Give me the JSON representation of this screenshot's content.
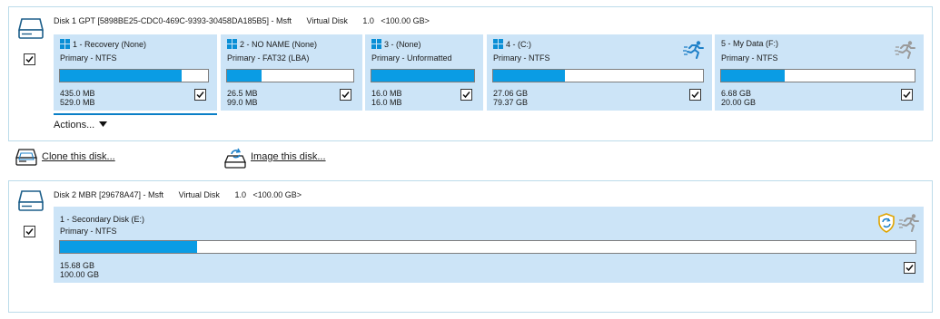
{
  "disk1": {
    "header": {
      "name": "Disk 1 GPT [5898BE25-CDC0-469C-9393-30458DA185B5] - Msft",
      "type": "Virtual Disk",
      "version": "1.0",
      "size": "<100.00 GB>"
    },
    "checked": true,
    "partitions": [
      {
        "title": "1 - Recovery (None)",
        "type": "Primary - NTFS",
        "used": "435.0 MB",
        "total": "529.0 MB",
        "fill": 0.82,
        "checked": true,
        "icon": "windows-icon"
      },
      {
        "title": "2 - NO NAME (None)",
        "type": "Primary - FAT32 (LBA)",
        "used": "26.5 MB",
        "total": "99.0 MB",
        "fill": 0.27,
        "checked": true,
        "icon": "windows-icon"
      },
      {
        "title": "3 - (None)",
        "type": "Primary - Unformatted",
        "used": "16.0 MB",
        "total": "16.0 MB",
        "fill": 1.0,
        "checked": true,
        "icon": "windows-icon"
      },
      {
        "title": "4 - (C:)",
        "type": "Primary - NTFS",
        "used": "27.06 GB",
        "total": "79.37 GB",
        "fill": 0.34,
        "checked": true,
        "icon": "windows-icon",
        "status_icon": "running-man-icon-blue"
      },
      {
        "title": "5 - My Data (F:)",
        "type": "Primary - NTFS",
        "used": "6.68 GB",
        "total": "20.00 GB",
        "fill": 0.33,
        "checked": true,
        "status_icon": "running-man-icon-grey"
      }
    ],
    "actions_label": "Actions..."
  },
  "links": {
    "clone": "Clone this disk...",
    "image": "Image this disk..."
  },
  "disk2": {
    "header": {
      "name": "Disk 2 MBR [29678A47] - Msft",
      "type": "Virtual Disk",
      "version": "1.0",
      "size": "<100.00 GB>"
    },
    "checked": true,
    "partitions": [
      {
        "title": "1 - Secondary Disk (E:)",
        "type": "Primary - NTFS",
        "used": "15.68 GB",
        "total": "100.00 GB",
        "fill": 0.16,
        "checked": true,
        "status_icons": [
          "shield-sync-icon",
          "running-man-icon-grey"
        ]
      }
    ]
  },
  "colors": {
    "partition_bg": "#cce4f7",
    "bar_fill": "#0a9ce4",
    "panel_border": "#bcdcea",
    "accent": "#0a7fc7"
  }
}
